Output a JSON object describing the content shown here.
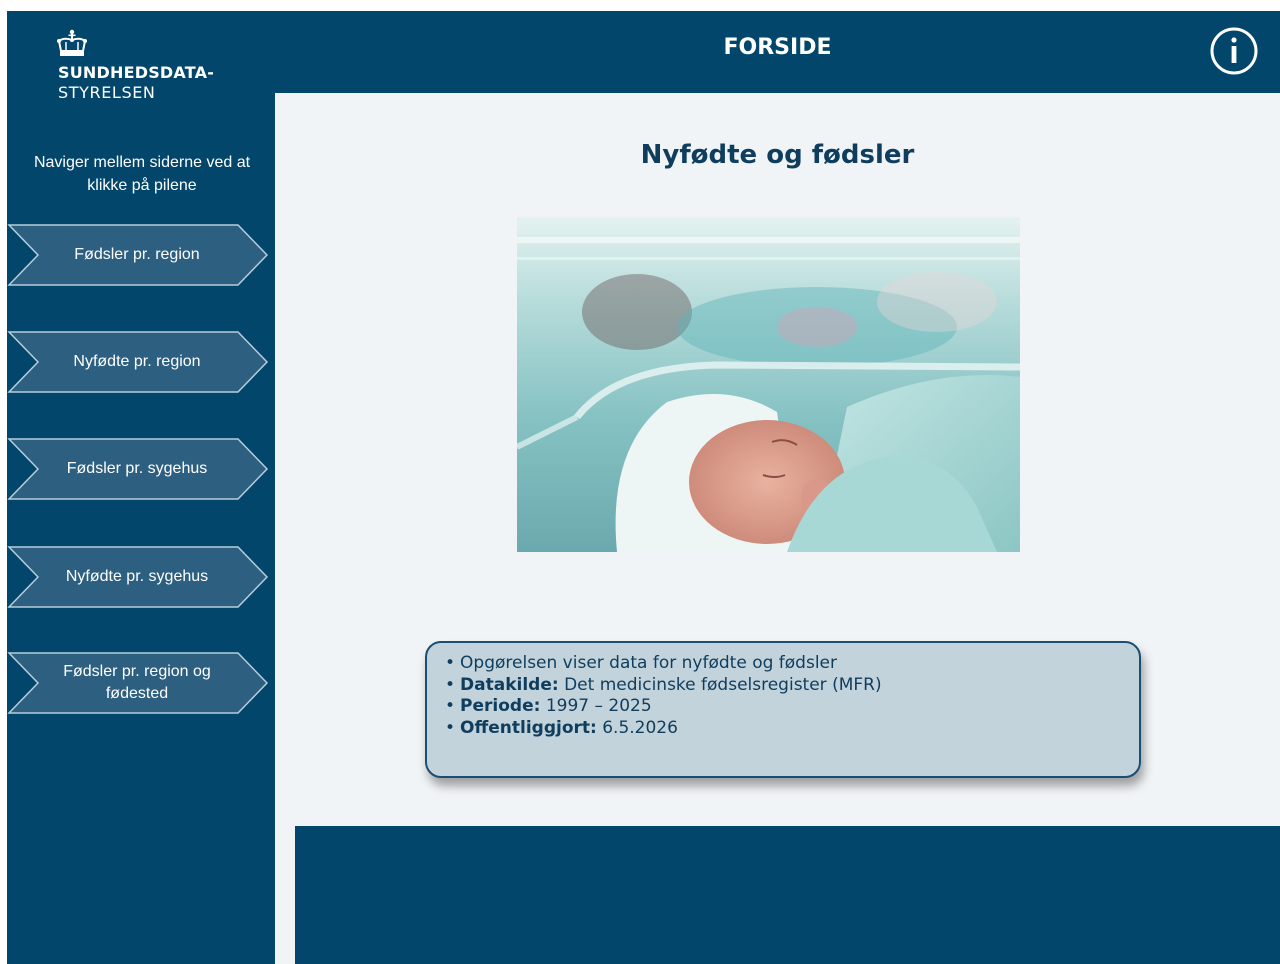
{
  "logo": {
    "line1": "SUNDHEDSDATA-",
    "line2": "STYRELSEN",
    "icon": "crown-icon"
  },
  "sidebar": {
    "hint": "Naviger mellem siderne ved at klikke på pilene",
    "items": [
      {
        "label": "Fødsler pr. region"
      },
      {
        "label": "Nyfødte pr. region"
      },
      {
        "label": "Fødsler pr. sygehus"
      },
      {
        "label": "Nyfødte pr. sygehus"
      },
      {
        "label": "Fødsler pr. region og fødested"
      }
    ]
  },
  "header": {
    "title": "FORSIDE",
    "info_icon": "info-icon"
  },
  "main": {
    "title": "Nyfødte og fødsler",
    "info": {
      "line1": "Opgørelsen viser data for nyfødte og fødsler",
      "source_label": "Datakilde:",
      "source_value": " Det medicinske fødselsregister (MFR)",
      "period_label": "Periode:",
      "period_value": " 1997 – 2025",
      "published_label": "Offentliggjort:",
      "published_value": " 6.5.2026"
    }
  },
  "colors": {
    "primary": "#02466b",
    "nav_button": "#2d5f80",
    "content_bg": "#f1f4f6",
    "title_text": "#0f3d5d",
    "infobox_bg": "#c3d3dc"
  }
}
